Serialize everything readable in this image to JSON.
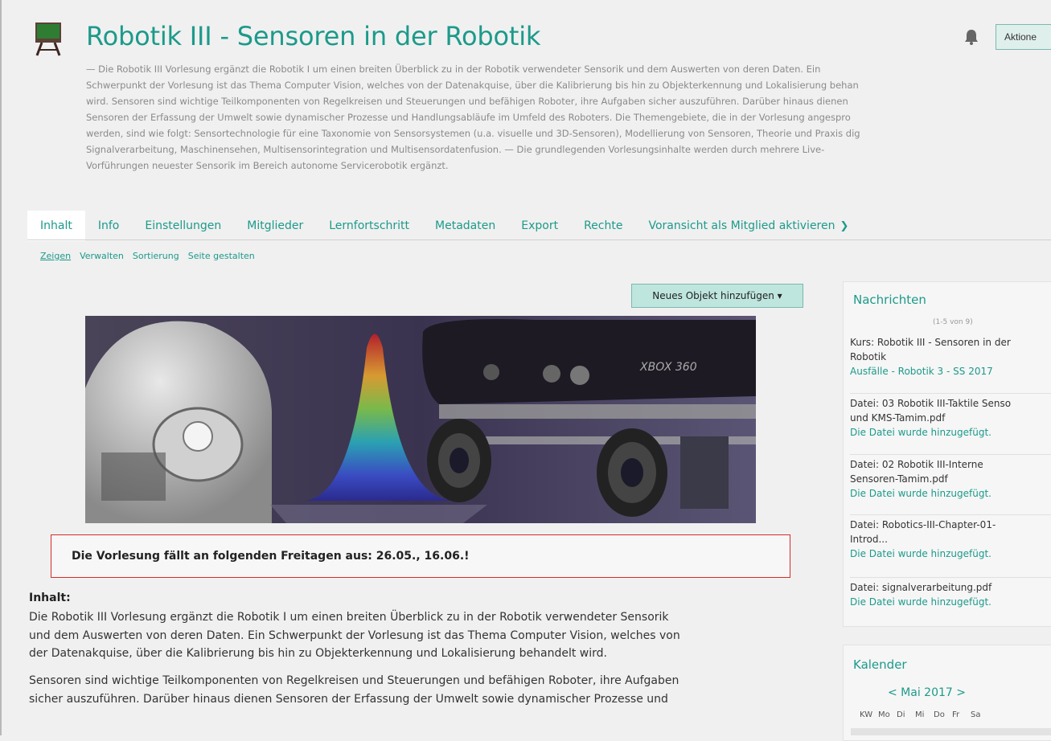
{
  "header": {
    "title": "Robotik III - Sensoren in der Robotik",
    "actions_label": "Aktione",
    "description_lines": [
      "— Die Robotik III Vorlesung ergänzt die Robotik I um einen breiten Überblick zu in der Robotik verwendeter Sensorik und dem Auswerten von deren Daten. Ein",
      "Schwerpunkt der Vorlesung ist das Thema Computer Vision, welches von der Datenakquise, über die Kalibrierung bis hin zu Objekterkennung und Lokalisierung behan",
      "wird. Sensoren sind wichtige Teilkomponenten von Regelkreisen und Steuerungen und befähigen Roboter, ihre Aufgaben sicher auszuführen. Darüber hinaus dienen",
      "Sensoren der Erfassung der Umwelt sowie dynamischer Prozesse und Handlungsabläufe im Umfeld des Roboters. Die Themengebiete, die in der Vorlesung angespro",
      "werden, sind wie folgt: Sensortechnologie für eine Taxonomie von Sensorsystemen (u.a. visuelle und 3D-Sensoren), Modellierung von Sensoren, Theorie und Praxis dig",
      "Signalverarbeitung, Maschinensehen, Multisensorintegration und Multisensordatenfusion. — Die grundlegenden Vorlesungsinhalte werden durch mehrere Live-",
      "Vorführungen neuester Sensorik im Bereich autonome Servicerobotik ergänzt."
    ]
  },
  "tabs": [
    "Inhalt",
    "Info",
    "Einstellungen",
    "Mitglieder",
    "Lernfortschritt",
    "Metadaten",
    "Export",
    "Rechte",
    "Voransicht als Mitglied aktivieren"
  ],
  "subtabs": [
    "Zeigen",
    "Verwalten",
    "Sortierung",
    "Seite gestalten"
  ],
  "add_object_button": "Neues Objekt hinzufügen",
  "banner_image_text": "XBOX 360",
  "notice": "Die Vorlesung fällt an folgenden Freitagen aus: 26.05., 16.06.!",
  "content": {
    "heading": "Inhalt:",
    "paragraph1_lines": [
      "Die Robotik III Vorlesung ergänzt die Robotik I um einen breiten Überblick zu in der Robotik verwendeter Sensorik",
      "und dem Auswerten von deren Daten. Ein Schwerpunkt der Vorlesung ist das Thema Computer Vision, welches von",
      "der Datenakquise, über die Kalibrierung bis hin zu Objekterkennung und Lokalisierung behandelt wird."
    ],
    "paragraph2_lines": [
      "Sensoren sind wichtige Teilkomponenten von Regelkreisen und Steuerungen und befähigen Roboter, ihre Aufgaben",
      "sicher auszuführen. Darüber hinaus dienen Sensoren der Erfassung der Umwelt sowie dynamischer Prozesse und"
    ]
  },
  "news": {
    "title": "Nachrichten",
    "count": "(1-5 von 9)",
    "items": [
      {
        "line1": "Kurs: Robotik III - Sensoren in der",
        "line2": "Robotik",
        "sub": "Ausfälle - Robotik 3 - SS 2017"
      },
      {
        "line1": "Datei: 03 Robotik III-Taktile Senso",
        "line2": "und KMS-Tamim.pdf",
        "sub": "Die Datei wurde hinzugefügt."
      },
      {
        "line1": "Datei: 02 Robotik III-Interne",
        "line2": "Sensoren-Tamim.pdf",
        "sub": "Die Datei wurde hinzugefügt."
      },
      {
        "line1": "Datei: Robotics-III-Chapter-01-",
        "line2": "Introd...",
        "sub": "Die Datei wurde hinzugefügt."
      },
      {
        "line1": "Datei: signalverarbeitung.pdf",
        "line2": "",
        "sub": "Die Datei wurde hinzugefügt."
      }
    ]
  },
  "calendar": {
    "title": "Kalender",
    "month_nav": "< Mai 2017 >",
    "day_headers": [
      "KW",
      "Mo",
      "Di",
      "Mi",
      "Do",
      "Fr",
      "Sa"
    ]
  },
  "colors": {
    "accent": "#1c9a8a",
    "notice_border": "#d82a2a"
  },
  "icons": {
    "course": "board-icon",
    "notifications": "bell-icon",
    "dropdown": "caret-down-icon",
    "more_tabs": "chevron-right-icon"
  }
}
